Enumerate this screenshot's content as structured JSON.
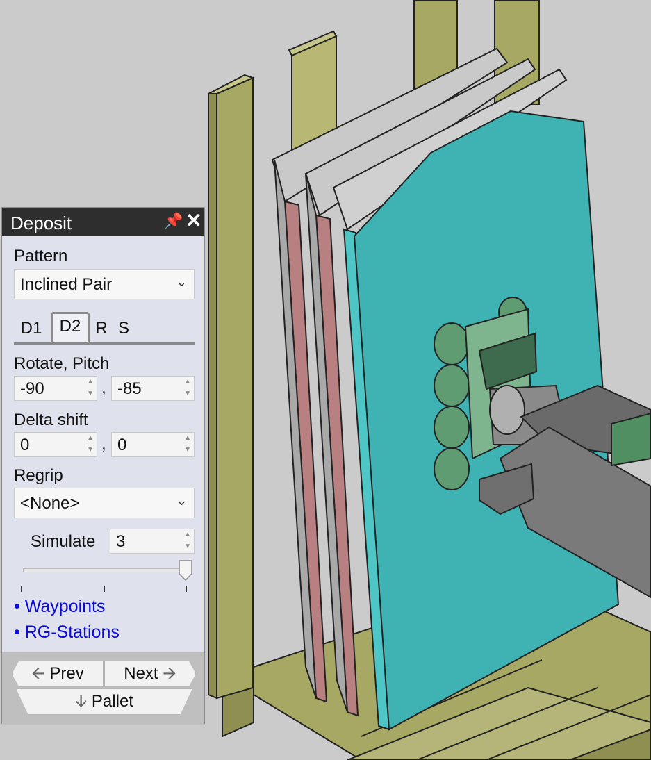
{
  "panel": {
    "title": "Deposit",
    "pattern_label": "Pattern",
    "pattern_value": "Inclined Pair",
    "tabs": [
      "D1",
      "D2",
      "R",
      "S"
    ],
    "active_tab": "D2",
    "rotate_pitch_label": "Rotate, Pitch",
    "rotate_value": "-90",
    "pitch_value": "-85",
    "delta_shift_label": "Delta shift",
    "delta_x": "0",
    "delta_y": "0",
    "separator": ",",
    "regrip_label": "Regrip",
    "regrip_value": "<None>",
    "simulate_label": "Simulate",
    "simulate_value": "3",
    "slider_level": 1.0,
    "links": [
      "• Waypoints",
      "• RG-Stations"
    ],
    "prev_label": "Prev",
    "next_label": "Next",
    "pallet_label": "Pallet"
  },
  "colors": {
    "background": "#cbcbcb",
    "wood": "#a8a865",
    "teal_panel": "#3fb3b3",
    "pink_panel": "#b88080",
    "gripper_green": "#5f9c72",
    "link": "#0a0ae0"
  }
}
